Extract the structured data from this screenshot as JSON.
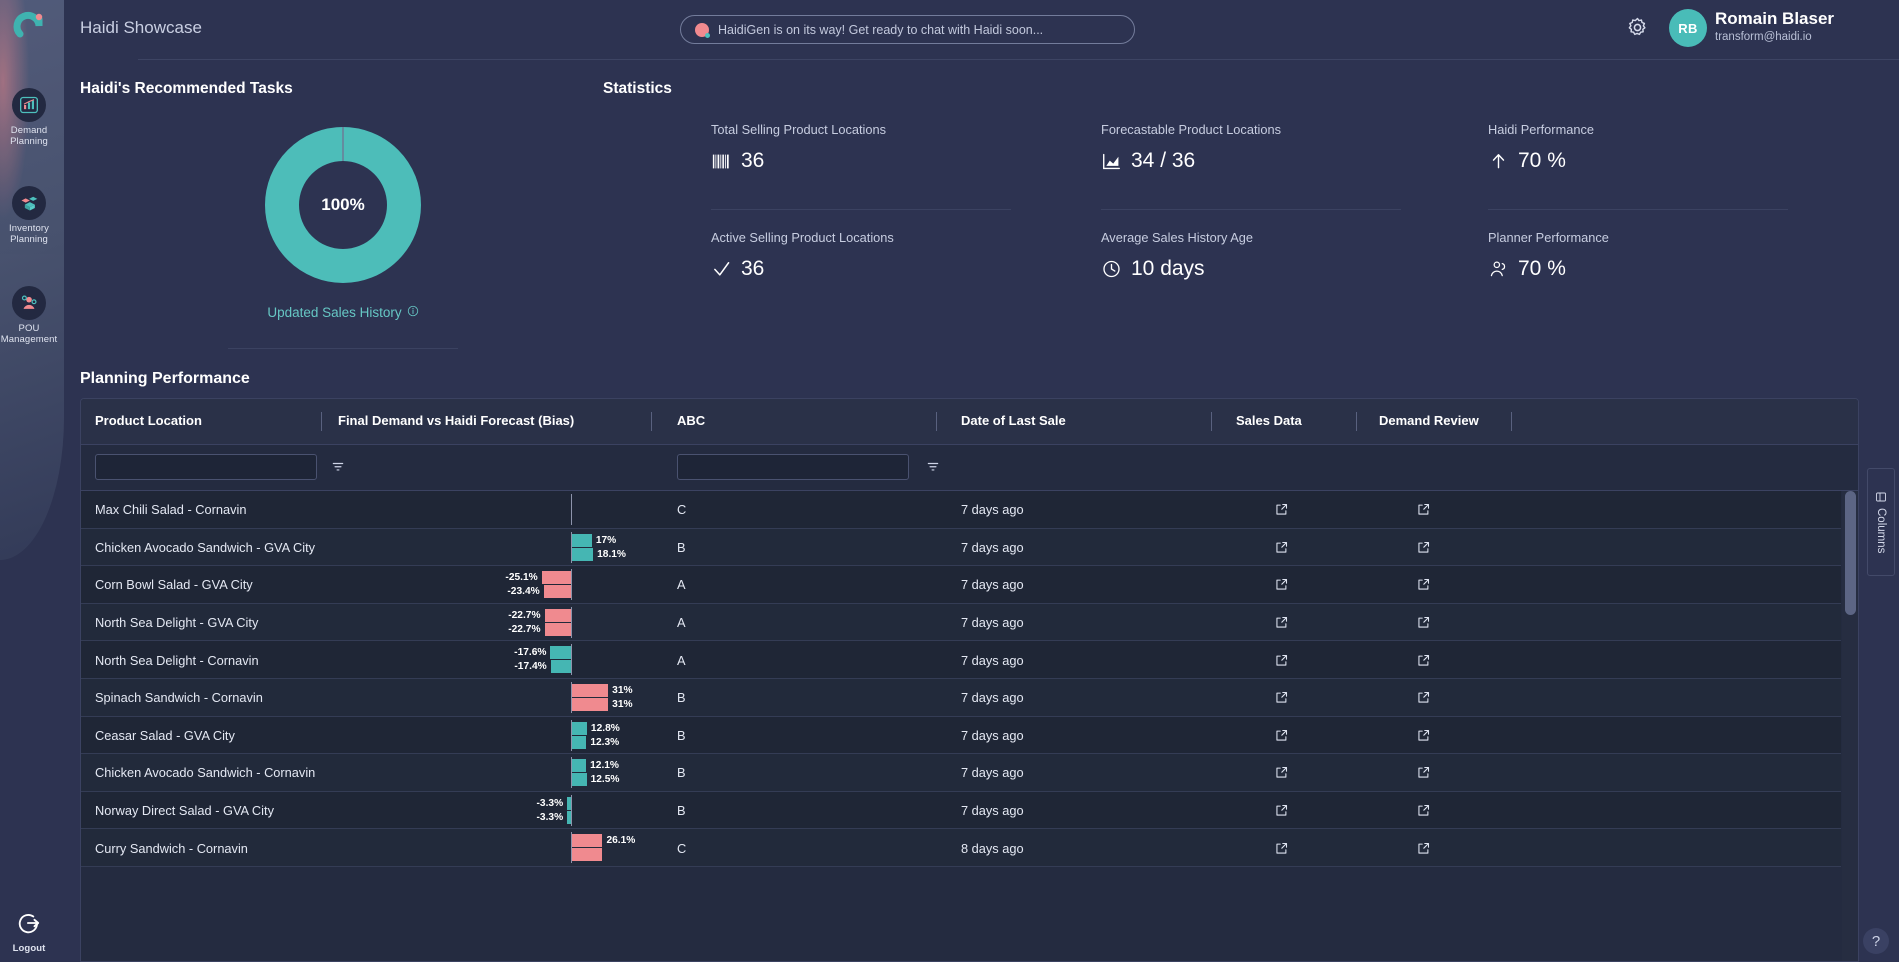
{
  "header": {
    "app_title": "Haidi Showcase",
    "banner_text": "HaidiGen is on its way! Get ready to chat with Haidi soon...",
    "gear_icon": "gear-icon",
    "user": {
      "initials": "RB",
      "name": "Romain Blaser",
      "email": "transform@haidi.io"
    }
  },
  "sidebar": {
    "logo": "haidi-logo",
    "items": [
      {
        "icon": "chart-bar-icon",
        "label_line1": "Demand",
        "label_line2": "Planning"
      },
      {
        "icon": "boxes-icon",
        "label_line1": "Inventory",
        "label_line2": "Planning"
      },
      {
        "icon": "people-gear-icon",
        "label_line1": "POU",
        "label_line2": "Management"
      }
    ],
    "logout": {
      "icon": "logout-icon",
      "label": "Logout"
    }
  },
  "tasks": {
    "title": "Haidi's Recommended Tasks",
    "donut_value": "100%",
    "donut_percent": 100,
    "caption": "Updated Sales History",
    "caption_icon": "info-icon"
  },
  "statistics": {
    "title": "Statistics",
    "cards": [
      {
        "label": "Total Selling Product Locations",
        "value": "36",
        "icon": "barcode-icon"
      },
      {
        "label": "Forecastable Product Locations",
        "value": "34 / 36",
        "icon": "area-chart-icon"
      },
      {
        "label": "Haidi Performance",
        "value": "70 %",
        "icon": "arrow-up-icon"
      },
      {
        "label": "Active Selling Product Locations",
        "value": "36",
        "icon": "check-icon"
      },
      {
        "label": "Average Sales History Age",
        "value": "10 days",
        "icon": "clock-icon"
      },
      {
        "label": "Planner Performance",
        "value": "70 %",
        "icon": "people-icon"
      }
    ]
  },
  "planning_performance": {
    "title": "Planning Performance",
    "columns": [
      "Product Location",
      "Final Demand vs Haidi Forecast (Bias)",
      "ABC",
      "Date of Last Sale",
      "Sales Data",
      "Demand Review"
    ],
    "filters": {
      "product_location_value": "",
      "product_location_placeholder": "",
      "abc_value": "",
      "abc_placeholder": "",
      "filter_icon": "filter-icon"
    },
    "row_action_icon": "open-external-icon",
    "rows": [
      {
        "name": "Max Chili Salad - Cornavin",
        "abc": "C",
        "date": "7 days ago",
        "bias": []
      },
      {
        "name": "Chicken Avocado Sandwich - GVA City",
        "abc": "B",
        "date": "7 days ago",
        "bias": [
          {
            "label": "17%",
            "value": 17,
            "color": "#45b6b3"
          },
          {
            "label": "18.1%",
            "value": 18.1,
            "color": "#45b6b3"
          }
        ]
      },
      {
        "name": "Corn Bowl Salad - GVA City",
        "abc": "A",
        "date": "7 days ago",
        "bias": [
          {
            "label": "-25.1%",
            "value": -25.1,
            "color": "#f08a8f"
          },
          {
            "label": "-23.4%",
            "value": -23.4,
            "color": "#f08a8f"
          }
        ]
      },
      {
        "name": "North Sea Delight - GVA City",
        "abc": "A",
        "date": "7 days ago",
        "bias": [
          {
            "label": "-22.7%",
            "value": -22.7,
            "color": "#f08a8f"
          },
          {
            "label": "-22.7%",
            "value": -22.7,
            "color": "#f08a8f"
          }
        ]
      },
      {
        "name": "North Sea Delight - Cornavin",
        "abc": "A",
        "date": "7 days ago",
        "bias": [
          {
            "label": "-17.6%",
            "value": -17.6,
            "color": "#45b6b3"
          },
          {
            "label": "-17.4%",
            "value": -17.4,
            "color": "#45b6b3"
          }
        ]
      },
      {
        "name": "Spinach Sandwich - Cornavin",
        "abc": "B",
        "date": "7 days ago",
        "bias": [
          {
            "label": "31%",
            "value": 31,
            "color": "#f08a8f"
          },
          {
            "label": "31%",
            "value": 31,
            "color": "#f08a8f"
          }
        ]
      },
      {
        "name": "Ceasar Salad - GVA City",
        "abc": "B",
        "date": "7 days ago",
        "bias": [
          {
            "label": "12.8%",
            "value": 12.8,
            "color": "#45b6b3"
          },
          {
            "label": "12.3%",
            "value": 12.3,
            "color": "#45b6b3"
          }
        ]
      },
      {
        "name": "Chicken Avocado Sandwich - Cornavin",
        "abc": "B",
        "date": "7 days ago",
        "bias": [
          {
            "label": "12.1%",
            "value": 12.1,
            "color": "#45b6b3"
          },
          {
            "label": "12.5%",
            "value": 12.5,
            "color": "#45b6b3"
          }
        ]
      },
      {
        "name": "Norway Direct Salad - GVA City",
        "abc": "B",
        "date": "7 days ago",
        "bias": [
          {
            "label": "-3.3%",
            "value": -3.3,
            "color": "#45b6b3"
          },
          {
            "label": "-3.3%",
            "value": -3.3,
            "color": "#45b6b3"
          }
        ]
      },
      {
        "name": "Curry Sandwich - Cornavin",
        "abc": "C",
        "date": "8 days ago",
        "bias": [
          {
            "label": "26.1%",
            "value": 26.1,
            "color": "#f08a8f"
          },
          {
            "label": "",
            "value": 26.1,
            "color": "#f08a8f"
          }
        ]
      }
    ],
    "columns_tab_label": "Columns",
    "columns_tab_icon": "columns-icon",
    "help_label": "?"
  },
  "colors": {
    "accent_teal": "#45b6b3",
    "accent_pink": "#f08a8f",
    "bg_app": "#2d3351",
    "bg_table": "#1f2636",
    "link": "#66c7c4"
  }
}
